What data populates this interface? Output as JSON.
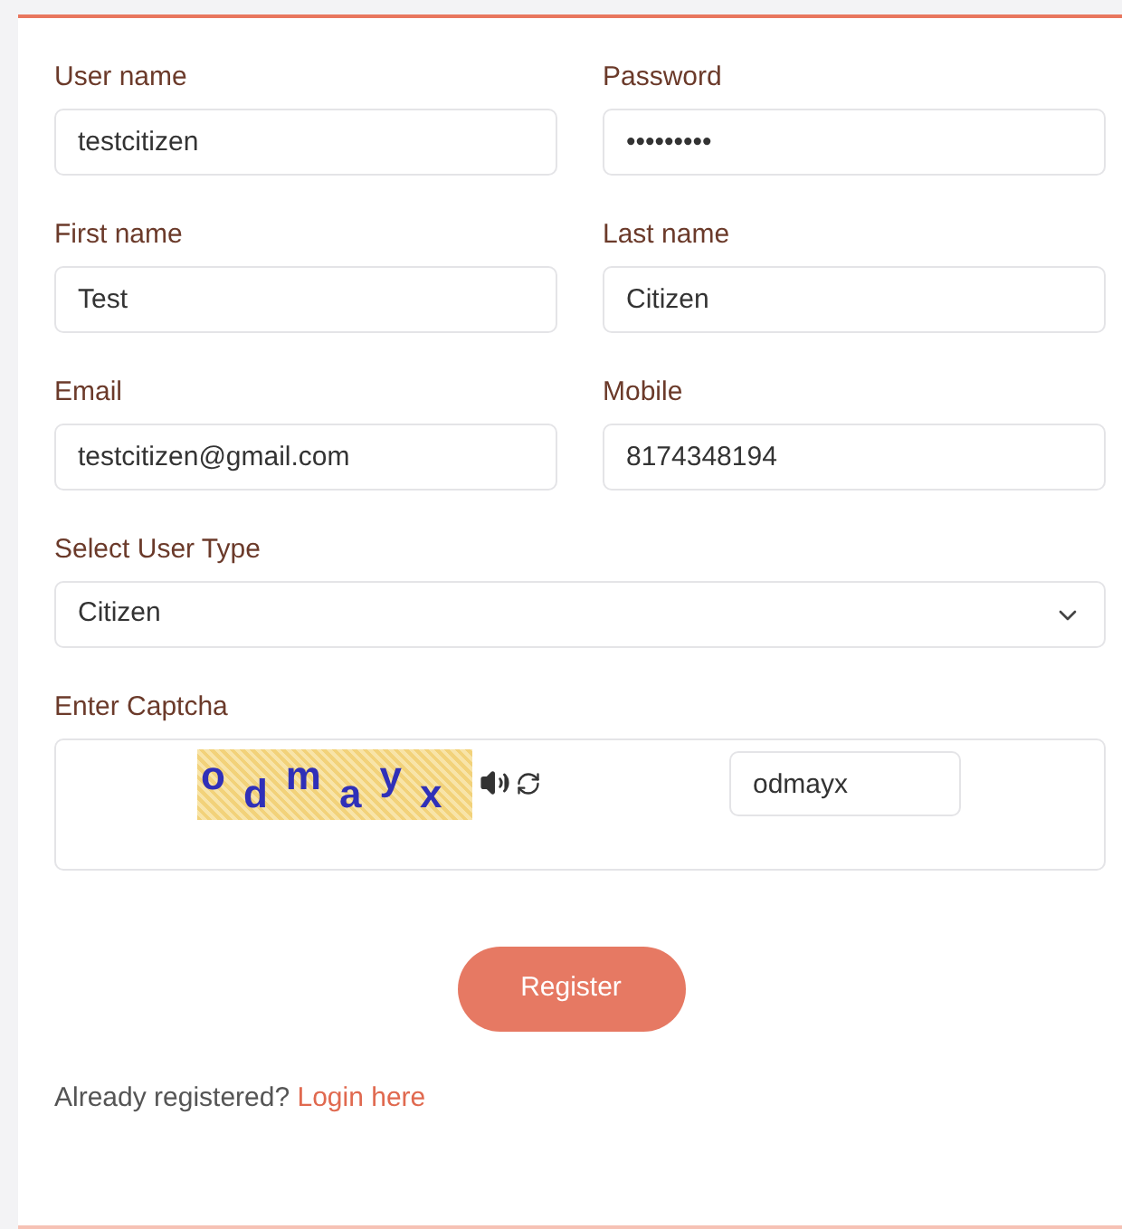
{
  "fields": [
    {
      "label": "User name",
      "value": "testcitizen"
    },
    {
      "label": "Password",
      "value": "•••••••••"
    },
    {
      "label": "First name",
      "value": "Test"
    },
    {
      "label": "Last name",
      "value": "Citizen"
    },
    {
      "label": "Email",
      "value": "testcitizen@gmail.com"
    },
    {
      "label": "Mobile",
      "value": "8174348194"
    }
  ],
  "user_type": {
    "label": "Select User Type",
    "value": "Citizen"
  },
  "captcha": {
    "label": "Enter Captcha",
    "characters": [
      "o",
      "d",
      "m",
      "a",
      "y",
      "x"
    ],
    "value": "odmayx"
  },
  "register_button": "Register",
  "footer": {
    "text": "Already registered?",
    "link": "Login here"
  }
}
